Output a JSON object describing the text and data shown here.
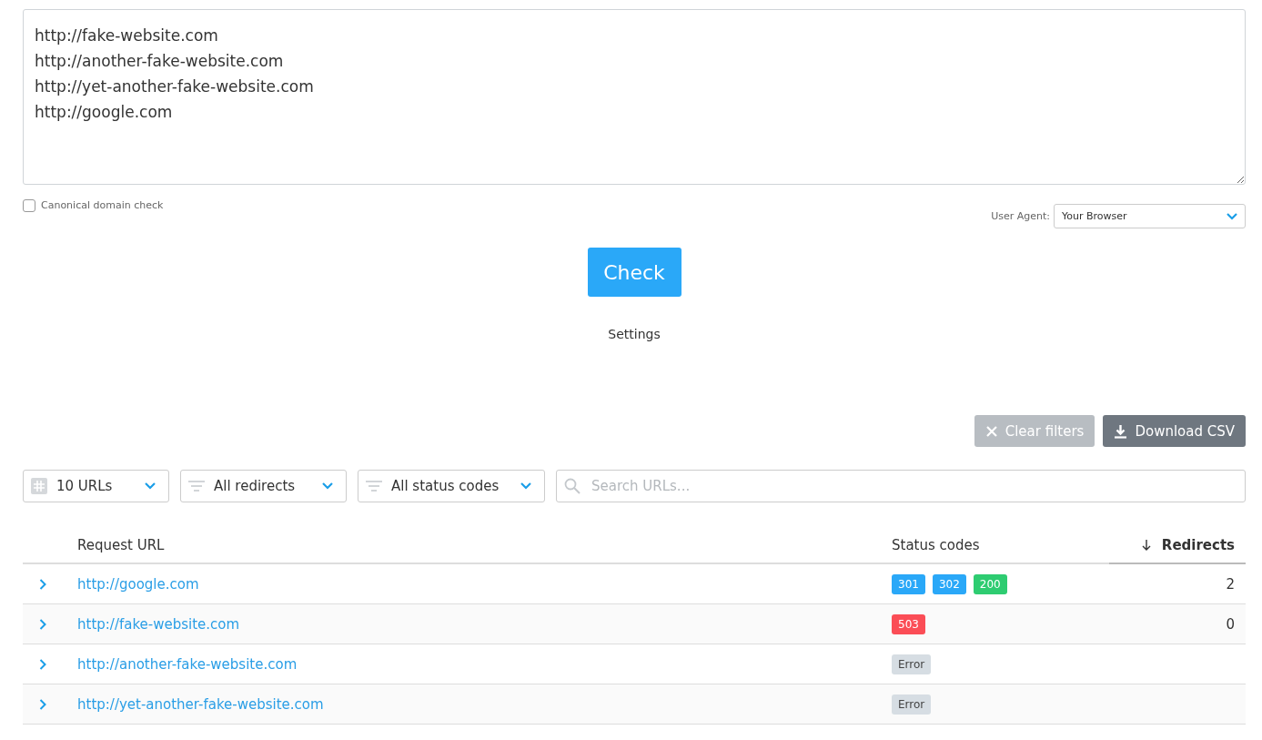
{
  "url_input": {
    "value": [
      "http://fake-website.com",
      "http://another-fake-website.com",
      "http://yet-another-fake-website.com",
      "http://google.com"
    ]
  },
  "canonical_check": {
    "label": "Canonical domain check",
    "checked": false
  },
  "user_agent": {
    "label": "User Agent:",
    "value": "Your Browser"
  },
  "check_button": "Check",
  "settings_link": "Settings",
  "actions": [
    {
      "kind": "clear",
      "label": "Clear filters",
      "disabled": true
    },
    {
      "kind": "download",
      "label": "Download CSV",
      "disabled": false
    }
  ],
  "filters": [
    {
      "kind": "count",
      "value": "10 URLs"
    },
    {
      "kind": "filter",
      "value": "All redirects"
    },
    {
      "kind": "filter",
      "value": "All status codes"
    }
  ],
  "search": {
    "placeholder": "Search URLs..."
  },
  "table": {
    "columns": [
      {
        "label": "Request URL",
        "sorted": false
      },
      {
        "label": "Status codes",
        "sorted": false
      },
      {
        "label": "Redirects",
        "sorted": true
      }
    ],
    "rows": [
      {
        "url": "http://google.com",
        "codes": [
          {
            "label": "301",
            "color": "#2aa8f8"
          },
          {
            "label": "302",
            "color": "#2aa8f8"
          },
          {
            "label": "200",
            "color": "#2ecc71"
          }
        ],
        "redirects": "2"
      },
      {
        "url": "http://fake-website.com",
        "codes": [
          {
            "label": "503",
            "color": "#fb4d56"
          }
        ],
        "redirects": "0"
      },
      {
        "url": "http://another-fake-website.com",
        "codes": [
          {
            "label": "Error",
            "color": "#d6dde3"
          }
        ]
      },
      {
        "url": "http://yet-another-fake-website.com",
        "codes": [
          {
            "label": "Error",
            "color": "#d6dde3"
          }
        ]
      }
    ]
  }
}
